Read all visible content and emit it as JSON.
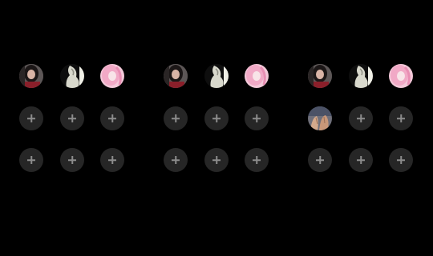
{
  "screen": {
    "background": "#000000"
  },
  "colors": {
    "add_slot_bg": "#262626",
    "add_slot_plus": "#8c8c8c"
  },
  "panels": [
    {
      "rows": [
        [
          "photo-dark-hair",
          "photo-white-figure",
          "photo-pink-hair"
        ],
        [
          "add",
          "add",
          "add"
        ],
        [
          "add",
          "add",
          "add"
        ]
      ]
    },
    {
      "rows": [
        [
          "photo-dark-hair",
          "photo-white-figure",
          "photo-pink-hair"
        ],
        [
          "add",
          "add",
          "add"
        ],
        [
          "add",
          "add",
          "add"
        ]
      ]
    },
    {
      "rows": [
        [
          "photo-dark-hair",
          "photo-white-figure",
          "photo-pink-hair"
        ],
        [
          "photo-hands",
          "add",
          "add"
        ],
        [
          "add",
          "add",
          "add"
        ]
      ]
    }
  ],
  "icons": {
    "add": "plus-icon"
  }
}
